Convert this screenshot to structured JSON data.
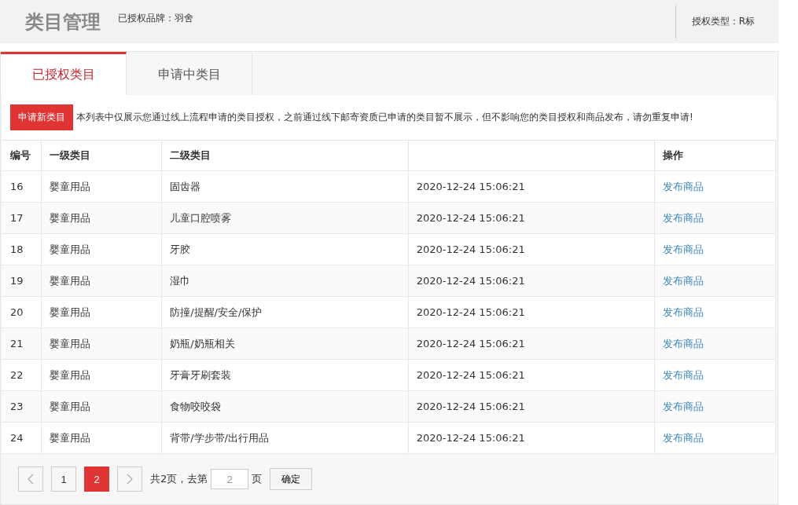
{
  "header": {
    "title": "类目管理",
    "brand": "已授权品牌：羽舍",
    "auth_type": "授权类型：R标"
  },
  "tabs": [
    {
      "label": "已授权类目",
      "selected": true
    },
    {
      "label": "申请中类目",
      "selected": false
    }
  ],
  "notice": {
    "button": "申请新类目",
    "text": "本列表中仅展示您通过线上流程申请的类目授权，之前通过线下邮寄资质已申请的类目暂不展示，但不影响您的类目授权和商品发布，请勿重复申请!"
  },
  "table": {
    "columns": [
      "编号",
      "一级类目",
      "二级类目",
      "操作"
    ],
    "rows": [
      {
        "id": "16",
        "level1": "婴童用品",
        "level2": "固齿器",
        "time": "2020-12-24 15:06:21",
        "action": "发布商品"
      },
      {
        "id": "17",
        "level1": "婴童用品",
        "level2": "儿童口腔喷雾",
        "time": "2020-12-24 15:06:21",
        "action": "发布商品"
      },
      {
        "id": "18",
        "level1": "婴童用品",
        "level2": "牙胶",
        "time": "2020-12-24 15:06:21",
        "action": "发布商品"
      },
      {
        "id": "19",
        "level1": "婴童用品",
        "level2": "湿巾",
        "time": "2020-12-24 15:06:21",
        "action": "发布商品"
      },
      {
        "id": "20",
        "level1": "婴童用品",
        "level2": "防撞/提醒/安全/保护",
        "time": "2020-12-24 15:06:21",
        "action": "发布商品"
      },
      {
        "id": "21",
        "level1": "婴童用品",
        "level2": "奶瓶/奶瓶相关",
        "time": "2020-12-24 15:06:21",
        "action": "发布商品"
      },
      {
        "id": "22",
        "level1": "婴童用品",
        "level2": "牙膏牙刷套装",
        "time": "2020-12-24 15:06:21",
        "action": "发布商品"
      },
      {
        "id": "23",
        "level1": "婴童用品",
        "level2": "食物咬咬袋",
        "time": "2020-12-24 15:06:21",
        "action": "发布商品"
      },
      {
        "id": "24",
        "level1": "婴童用品",
        "level2": "背带/学步带/出行用品",
        "time": "2020-12-24 15:06:21",
        "action": "发布商品"
      }
    ]
  },
  "pagination": {
    "pages": [
      {
        "label": "1",
        "selected": false
      },
      {
        "label": "2",
        "selected": true
      }
    ],
    "total": "共2页，去第",
    "goto_value": "2",
    "unit": "页",
    "confirm": "确定"
  }
}
